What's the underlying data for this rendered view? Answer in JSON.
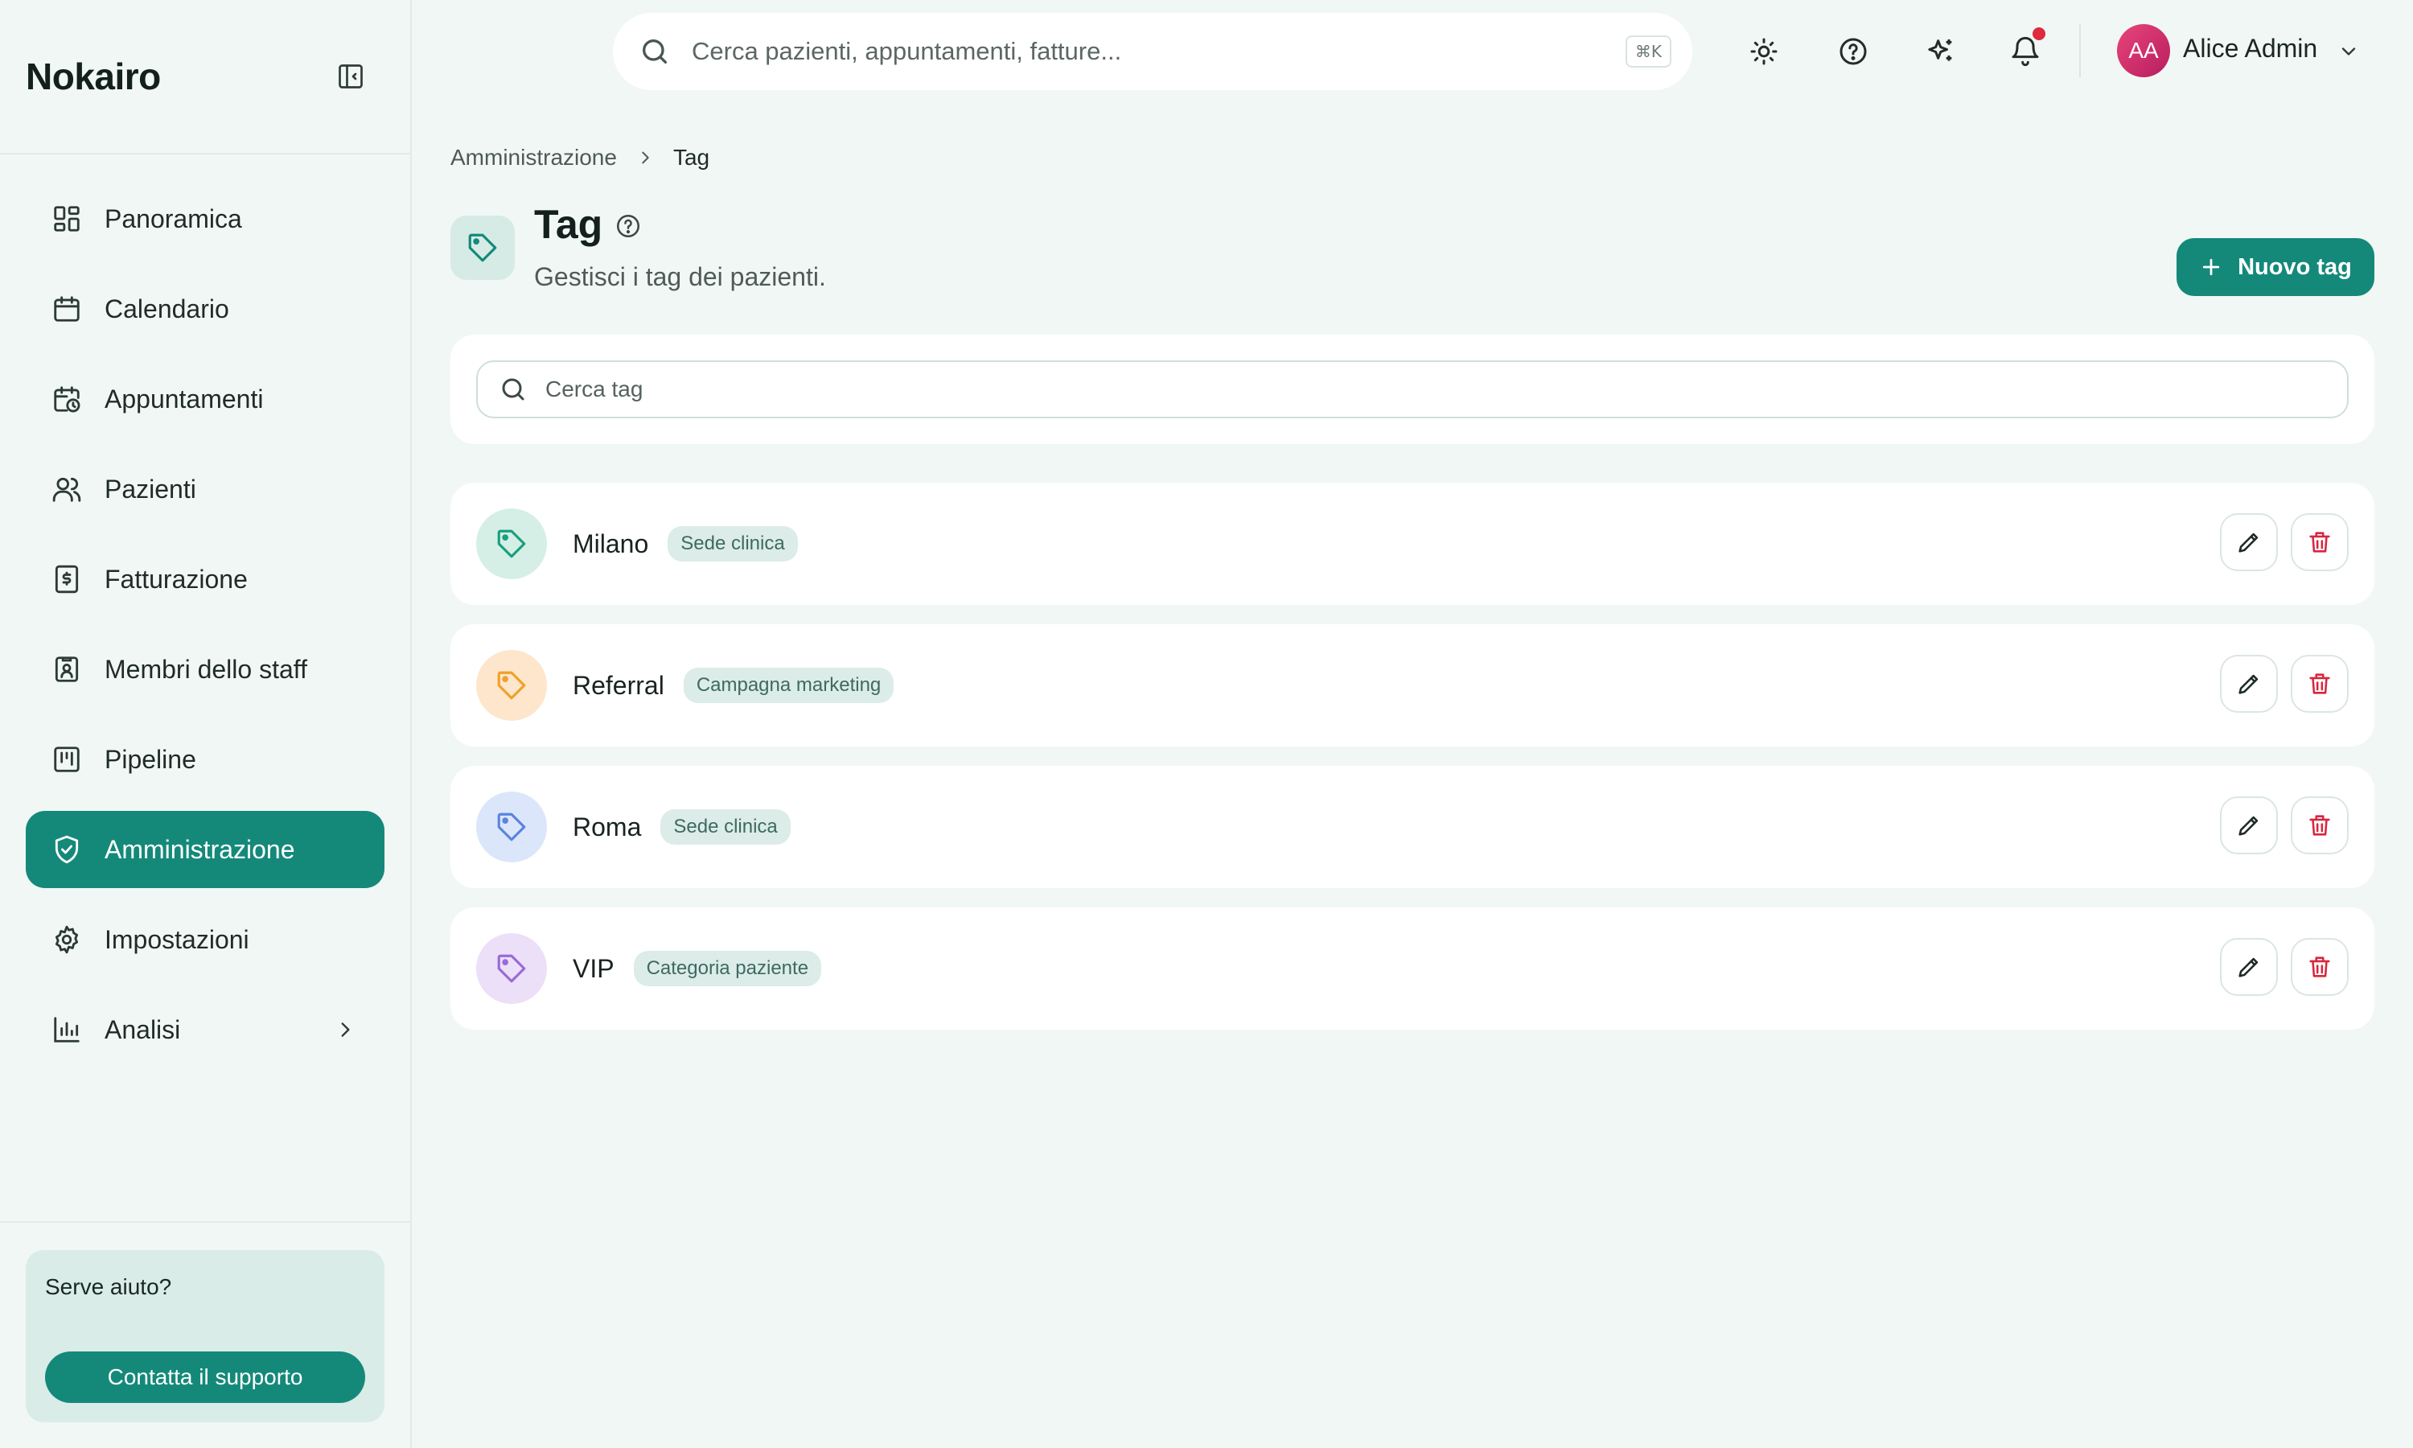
{
  "app": {
    "name": "Nokairo"
  },
  "sidebar": {
    "items": [
      {
        "label": "Panoramica",
        "icon": "dashboard-icon"
      },
      {
        "label": "Calendario",
        "icon": "calendar-icon"
      },
      {
        "label": "Appuntamenti",
        "icon": "calendar-clock-icon"
      },
      {
        "label": "Pazienti",
        "icon": "users-icon"
      },
      {
        "label": "Fatturazione",
        "icon": "invoice-icon"
      },
      {
        "label": "Membri dello staff",
        "icon": "id-badge-icon"
      },
      {
        "label": "Pipeline",
        "icon": "kanban-icon"
      },
      {
        "label": "Amministrazione",
        "icon": "shield-check-icon",
        "active": true
      },
      {
        "label": "Impostazioni",
        "icon": "gear-icon"
      },
      {
        "label": "Analisi",
        "icon": "bar-chart-icon",
        "expandable": true
      }
    ],
    "help": {
      "title": "Serve aiuto?",
      "button": "Contatta il supporto"
    }
  },
  "topbar": {
    "search_placeholder": "Cerca pazienti, appuntamenti, fatture...",
    "shortcut": "⌘K",
    "user": {
      "initials": "AA",
      "name": "Alice Admin"
    },
    "has_notification": true
  },
  "breadcrumb": {
    "parent": "Amministrazione",
    "current": "Tag"
  },
  "page": {
    "title": "Tag",
    "subtitle": "Gestisci i tag dei pazienti.",
    "new_button": "Nuovo tag",
    "filter_placeholder": "Cerca tag"
  },
  "tags": [
    {
      "name": "Milano",
      "category": "Sede clinica",
      "bg": "#d5efe7",
      "fg": "#19a07e"
    },
    {
      "name": "Referral",
      "category": "Campagna marketing",
      "bg": "#fde6cc",
      "fg": "#f0a02a"
    },
    {
      "name": "Roma",
      "category": "Sede clinica",
      "bg": "#dbe6fb",
      "fg": "#5b84dc"
    },
    {
      "name": "VIP",
      "category": "Categoria paziente",
      "bg": "#ece0f8",
      "fg": "#9a6ad8"
    }
  ],
  "colors": {
    "accent": "#14897a",
    "danger": "#d8263f",
    "background": "#f1f7f5"
  }
}
